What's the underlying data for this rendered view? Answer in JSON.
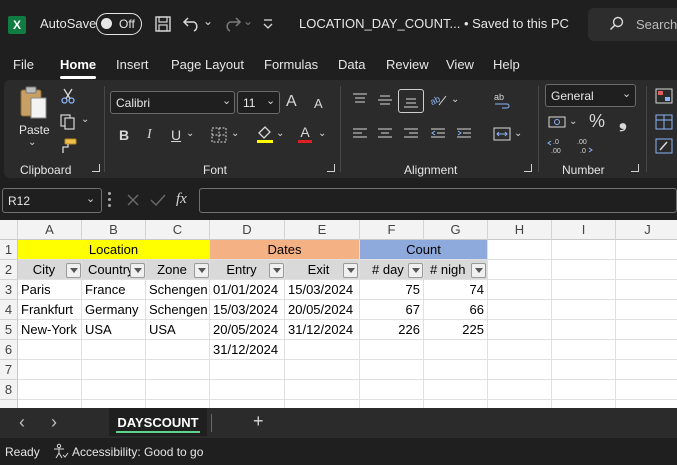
{
  "window": {
    "autosave_label": "AutoSave",
    "autosave_state": "Off",
    "doc_title": "LOCATION_DAY_COUNT... • Saved to this PC",
    "search_placeholder": "Search",
    "chevron": "⌄"
  },
  "menu": [
    "File",
    "Home",
    "Insert",
    "Page Layout",
    "Formulas",
    "Data",
    "Review",
    "View",
    "Help"
  ],
  "ribbon": {
    "clipboard": {
      "label": "Clipboard",
      "paste_label": "Paste"
    },
    "font": {
      "label": "Font",
      "font_name": "Calibri",
      "font_size": "11",
      "grow": "A",
      "shrink": "A",
      "bold": "B",
      "italic": "I",
      "underline": "U",
      "color_letter": "A"
    },
    "alignment": {
      "label": "Alignment"
    },
    "number": {
      "label": "Number",
      "format": "General",
      "percent": "%",
      "comma": "❟",
      "inc_decimal": "←.0 .00",
      "dec_decimal": ".00 →.0"
    }
  },
  "formula_bar": {
    "name_box": "R12",
    "fx": "fx",
    "content": ""
  },
  "sheet": {
    "columns": [
      "A",
      "B",
      "C",
      "D",
      "E",
      "F",
      "G",
      "H",
      "I",
      "J"
    ],
    "rows": [
      "1",
      "2",
      "3",
      "4",
      "5",
      "6",
      "7",
      "8"
    ],
    "group_headers": {
      "location": "Location",
      "dates": "Dates",
      "count": "Count"
    },
    "field_headers": [
      "City",
      "Country",
      "Zone",
      "Entry",
      "Exit",
      "# day",
      "# nigh"
    ],
    "data": [
      {
        "city": "Paris",
        "country": "France",
        "zone": "Schengen",
        "entry": "01/01/2024",
        "exit": "15/03/2024",
        "days": "75",
        "nights": "74"
      },
      {
        "city": "Frankfurt",
        "country": "Germany",
        "zone": "Schengen",
        "entry": "15/03/2024",
        "exit": "20/05/2024",
        "days": "67",
        "nights": "66"
      },
      {
        "city": "New-York",
        "country": "USA",
        "zone": "USA",
        "entry": "20/05/2024",
        "exit": "31/12/2024",
        "days": "226",
        "nights": "225"
      }
    ],
    "extra_entry": "31/12/2024",
    "colors": {
      "location": "#ffff00",
      "dates": "#f4b183",
      "count": "#8ea9db",
      "headers": "#d9d9d9"
    }
  },
  "tabs": {
    "active": "DAYSCOUNT",
    "add": "+",
    "prev": "‹",
    "next": "›"
  },
  "status": {
    "ready": "Ready",
    "accessibility": "Accessibility: Good to go"
  },
  "icons": [
    "excel-logo-icon",
    "save-icon",
    "undo-icon",
    "redo-icon",
    "search-icon",
    "paste-icon",
    "cut-icon",
    "copy-icon",
    "format-painter-icon",
    "wrap-text-icon",
    "merge-icon",
    "currency-icon",
    "conditional-format-icon",
    "accessibility-icon"
  ]
}
